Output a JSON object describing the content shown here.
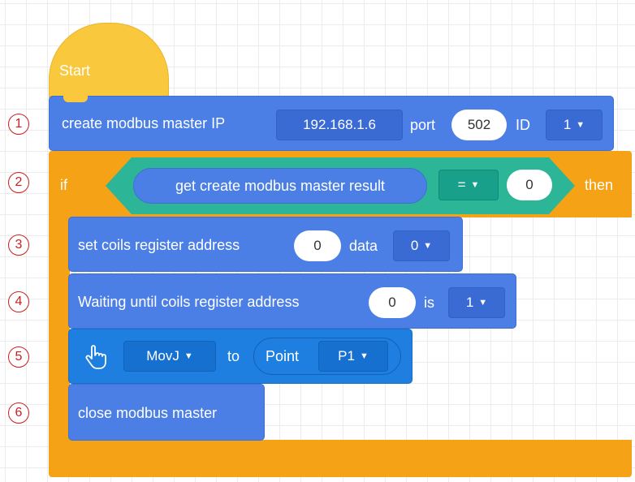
{
  "colors": {
    "motion": "#4c7fe5",
    "control": "#f5a216",
    "event": "#f9c83d",
    "operator": "#2cb596",
    "annotation": "#cc1e1e"
  },
  "annotations": [
    "1",
    "2",
    "3",
    "4",
    "5",
    "6"
  ],
  "start": {
    "label": "Start"
  },
  "create_master": {
    "label": "create modbus master IP",
    "ip": "192.168.1.6",
    "port_label": "port",
    "port": "502",
    "id_label": "ID",
    "id": "1"
  },
  "if_block": {
    "if_label": "if",
    "then_label": "then",
    "condition": {
      "reporter": "get create modbus master result",
      "operator": "=",
      "value": "0"
    }
  },
  "set_coils": {
    "label": "set coils register address",
    "address": "0",
    "data_label": "data",
    "data": "0"
  },
  "wait_coils": {
    "label": "Waiting until coils register address",
    "address": "0",
    "is_label": "is",
    "value": "1"
  },
  "movj": {
    "icon": "hand-pointer-icon",
    "mode": "MovJ",
    "to_label": "to",
    "point_label": "Point",
    "point": "P1"
  },
  "close_master": {
    "label": "close modbus master"
  }
}
